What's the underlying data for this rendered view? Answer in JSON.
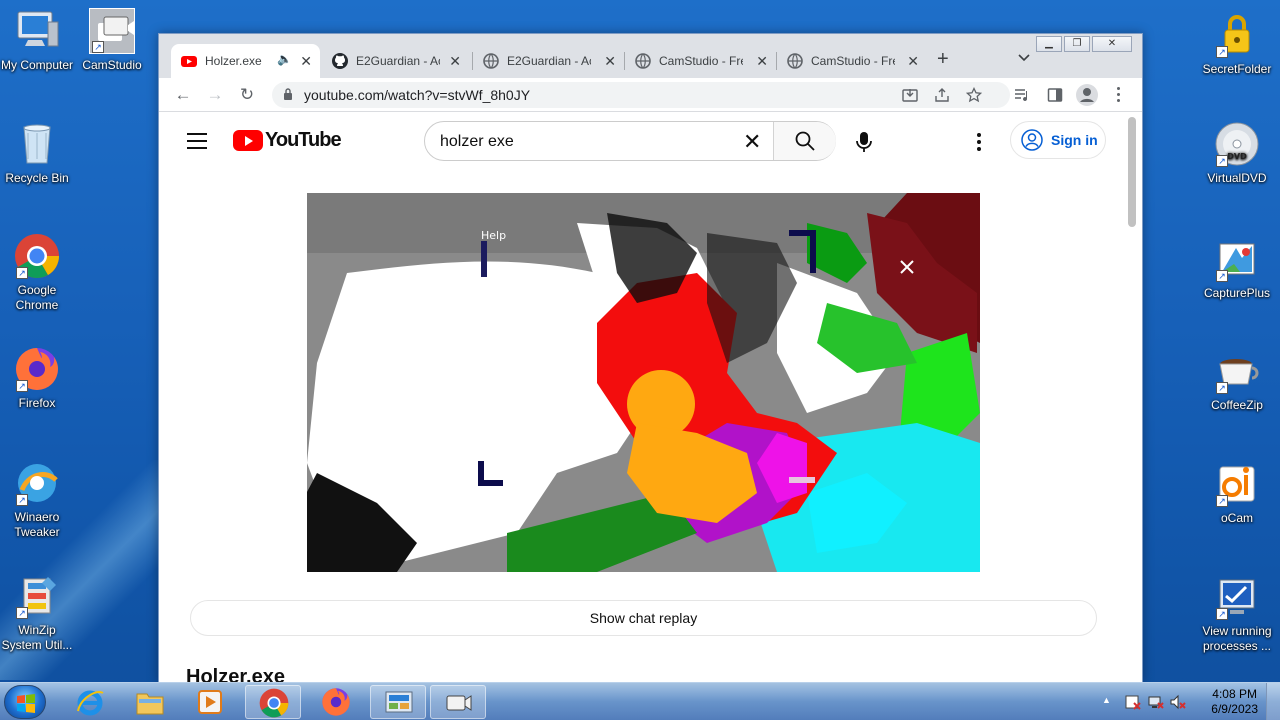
{
  "desktop": {
    "left_icons": [
      {
        "label": "My Computer",
        "icon": "computer-icon"
      },
      {
        "label": "CamStudio",
        "icon": "camstudio-icon"
      },
      {
        "label": "Recycle Bin",
        "icon": "recycle-bin-icon"
      },
      {
        "label": "Google Chrome",
        "icon": "chrome-icon"
      },
      {
        "label": "Firefox",
        "icon": "firefox-icon"
      },
      {
        "label": "Winaero Tweaker",
        "icon": "winaero-icon"
      },
      {
        "label": "WinZip System Util...",
        "icon": "winzip-icon"
      }
    ],
    "right_icons": [
      {
        "label": "SecretFolder",
        "icon": "lock-folder-icon"
      },
      {
        "label": "VirtualDVD",
        "icon": "dvd-icon"
      },
      {
        "label": "CapturePlus",
        "icon": "captureplus-icon"
      },
      {
        "label": "CoffeeZip",
        "icon": "coffeezip-icon"
      },
      {
        "label": "oCam",
        "icon": "ocam-icon"
      },
      {
        "label": "View running processes ...",
        "icon": "processes-icon"
      }
    ]
  },
  "browser": {
    "tabs": [
      {
        "title": "Holzer.exe -",
        "favicon": "youtube-icon",
        "active": true,
        "audio": true
      },
      {
        "title": "E2Guardian - Ac",
        "favicon": "github-icon",
        "active": false
      },
      {
        "title": "E2Guardian - Ac",
        "favicon": "globe-icon",
        "active": false
      },
      {
        "title": "CamStudio - Fre",
        "favicon": "globe-icon",
        "active": false
      },
      {
        "title": "CamStudio - Fre",
        "favicon": "globe-icon",
        "active": false
      }
    ],
    "new_tab": "+",
    "url": "youtube.com/watch?v=stvWf_8h0JY"
  },
  "youtube": {
    "logo_text": "YouTube",
    "search_value": "holzer exe",
    "sign_in": "Sign in",
    "chat_replay": "Show chat replay",
    "video_title": "Holzer.exe",
    "video_overlay_text": "Help"
  },
  "taskbar": {
    "time": "4:08 PM",
    "date": "6/9/2023",
    "pinned": [
      "ie-icon",
      "explorer-icon",
      "media-player-icon",
      "chrome-icon",
      "firefox-icon",
      "control-panel-icon",
      "camstudio-icon"
    ]
  },
  "colors": {
    "youtube_red": "#ff0000",
    "link_blue": "#065fd4",
    "desktop_blue": "#1760b8"
  }
}
